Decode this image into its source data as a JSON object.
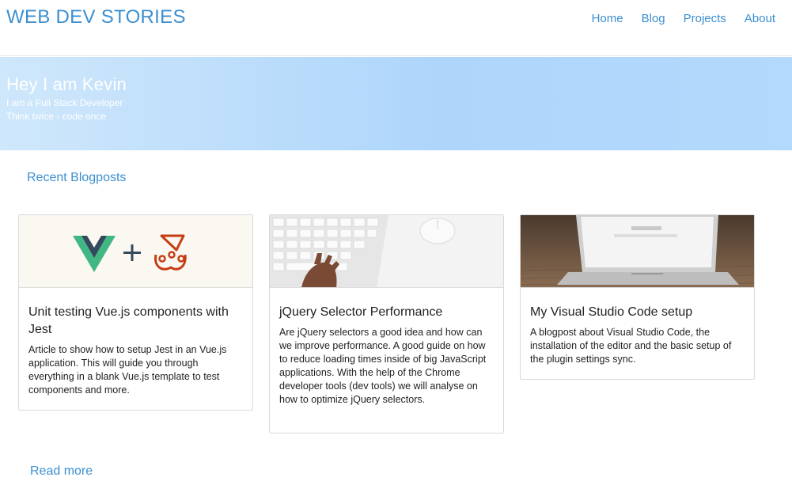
{
  "header": {
    "site_title": "WEB DEV STORIES",
    "nav": [
      "Home",
      "Blog",
      "Projects",
      "About"
    ]
  },
  "hero": {
    "title": "Hey I am Kevin",
    "subtitle1": "I am a Full Stack Developer",
    "subtitle2": "Think twice - code once"
  },
  "section": {
    "title": "Recent Blogposts",
    "read_more": "Read more"
  },
  "posts": [
    {
      "title": "Unit testing Vue.js components with Jest",
      "excerpt": "Article to show how to setup Jest in an Vue.js application. This will guide you through everything in a blank Vue.js template to test components and more.",
      "image": "vue-plus-jest-logo"
    },
    {
      "title": "jQuery Selector Performance",
      "excerpt": "Are jQuery selectors a good idea and how can we improve performance. A good guide on how to reduce loading times inside of big JavaScript applications. With the help of the Chrome developer tools (dev tools) we will analyse on how to optimize jQuery selectors.",
      "image": "keyboard-typing-photo"
    },
    {
      "title": "My Visual Studio Code setup",
      "excerpt": "A blogpost about Visual Studio Code, the installation of the editor and the basic setup of the plugin settings sync.",
      "image": "laptop-on-table-photo"
    }
  ],
  "colors": {
    "accent": "#3b8fd0",
    "hero_start": "#cfe7fb",
    "hero_end": "#b3d9fc"
  }
}
